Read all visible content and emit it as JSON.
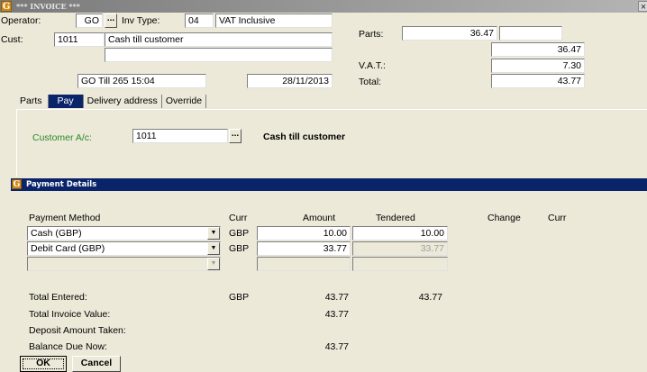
{
  "window": {
    "title": "*** INVOICE ***",
    "icon_letter": "G",
    "close_glyph": "×"
  },
  "header": {
    "operator_label": "Operator:",
    "operator_value": "GO",
    "ellipsis": "...",
    "inv_type_label": "Inv Type:",
    "inv_type_code": "04",
    "inv_type_name": "VAT Inclusive",
    "cust_label": "Cust:",
    "cust_code": "1011",
    "cust_name": "Cash till customer",
    "till_info": "GO  Till 265 15:04",
    "date": "28/11/2013"
  },
  "totals": {
    "parts_label": "Parts:",
    "parts_value": "36.47",
    "subtotal": "36.47",
    "vat_label": "V.A.T.:",
    "vat_value": "7.30",
    "total_label": "Total:",
    "total_value": "43.77"
  },
  "tabs": [
    {
      "label": "Parts"
    },
    {
      "label": "Pay"
    },
    {
      "label": "Delivery address"
    },
    {
      "label": "Override"
    }
  ],
  "pay": {
    "customer_label": "Customer A/c:",
    "customer_code": "1011",
    "customer_name": "Cash till customer"
  },
  "payment_details": {
    "title": "Payment Details",
    "col_method": "Payment Method",
    "col_curr": "Curr",
    "col_amount": "Amount",
    "col_tendered": "Tendered",
    "col_change": "Change",
    "col_curr2": "Curr",
    "rows": [
      {
        "method": "Cash (GBP)",
        "curr": "GBP",
        "amount": "10.00",
        "tendered": "10.00"
      },
      {
        "method": "Debit Card (GBP)",
        "curr": "GBP",
        "amount": "33.77",
        "tendered": "33.77"
      },
      {
        "method": "",
        "curr": "",
        "amount": "",
        "tendered": ""
      }
    ],
    "total_entered_label": "Total Entered:",
    "total_entered_curr": "GBP",
    "total_entered_amount": "43.77",
    "total_entered_tendered": "43.77",
    "total_invoice_label": "Total Invoice Value:",
    "total_invoice_amount": "43.77",
    "deposit_label": "Deposit Amount Taken:",
    "balance_label": "Balance Due Now:",
    "balance_amount": "43.77"
  },
  "buttons": {
    "ok": "OK",
    "cancel": "Cancel"
  },
  "colors": {
    "selection": "#0a246a",
    "title_icon": "#d08a18",
    "customer_label": "#2a8a2a"
  }
}
